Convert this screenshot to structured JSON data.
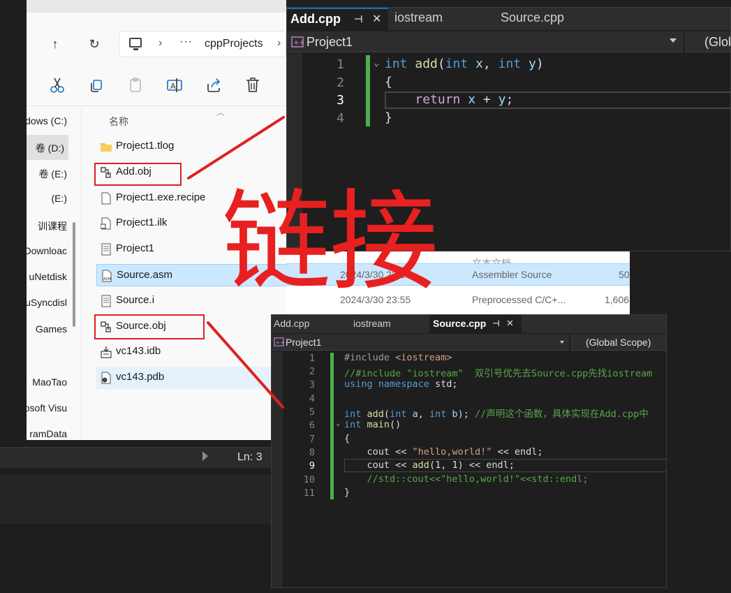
{
  "explorer": {
    "address": {
      "ellipsis": "···",
      "sep": "›",
      "folder": "cppProjects"
    },
    "sidebar": [
      "dows (C:)",
      "卷 (D:)",
      "卷 (E:)",
      "(E:)",
      "训课程",
      "Downloac",
      "uNetdisk",
      "uSyncdisl",
      "Games",
      "",
      "MaoTao",
      "osoft Visu",
      "ramData"
    ],
    "column_name": "名称",
    "files": [
      {
        "name": "Project1.tlog",
        "type": "folder"
      },
      {
        "name": "Add.obj",
        "type": "obj"
      },
      {
        "name": "Project1.exe.recipe",
        "type": "file"
      },
      {
        "name": "Project1.ilk",
        "type": "ilk"
      },
      {
        "name": "Project1",
        "type": "text"
      },
      {
        "name": "Source.asm",
        "type": "asm"
      },
      {
        "name": "Source.i",
        "type": "text"
      },
      {
        "name": "Source.obj",
        "type": "obj"
      },
      {
        "name": "vc143.idb",
        "type": "idb"
      },
      {
        "name": "vc143.pdb",
        "type": "pdb"
      }
    ],
    "ext_rows": [
      {
        "date": "",
        "type": "文本文档",
        "size": ""
      },
      {
        "date": "2024/3/30 23:14",
        "type": "Assembler Source",
        "size": "50"
      },
      {
        "date": "2024/3/30 23:55",
        "type": "Preprocessed C/C+...",
        "size": "1,606"
      }
    ]
  },
  "status": {
    "ln": "Ln: 3"
  },
  "vs_top": {
    "tabs": [
      "Add.cpp",
      "iostream",
      "Source.cpp"
    ],
    "pin": "⊣",
    "close": "✕",
    "project": "Project1",
    "scope": "(Glob",
    "lines": [
      "1",
      "2",
      "3",
      "4"
    ]
  },
  "vs_bottom": {
    "tabs": [
      "Add.cpp",
      "iostream",
      "Source.cpp"
    ],
    "pin": "⊣",
    "close": "✕",
    "project": "Project1",
    "scope": "(Global Scope)",
    "lines": [
      "1",
      "2",
      "3",
      "4",
      "5",
      "6",
      "7",
      "8",
      "9",
      "10",
      "11"
    ],
    "code": {
      "l1_inc": "#include ",
      "l1_hdr": "<iostream>",
      "l2": "//#include \"iostream\"  双引号优先去Source.cpp先找iostream",
      "l3_kw": "using namespace",
      "l3_rest": " std;",
      "l5_cmt": "//声明这个函数，具体实现在Add.cpp中",
      "l8_str": "\"hello,world!\"",
      "l10": "//std::cout<<\"hello,world!\"<<std::endl;"
    }
  },
  "overlay": {
    "big_text": "链接"
  },
  "colors": {
    "annotation_red": "#e02020",
    "vs_bg": "#1e1e1e",
    "selection": "#cce8ff",
    "change_bar": "#4caf50"
  }
}
